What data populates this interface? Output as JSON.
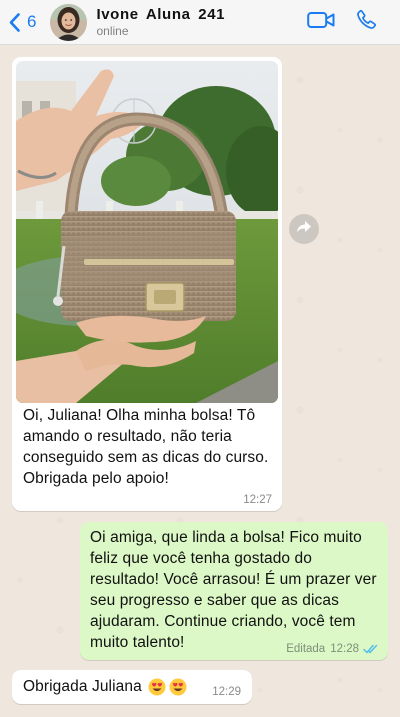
{
  "header": {
    "back_count": "6",
    "contact_name": "Ivone  Aluna  241",
    "status": "online",
    "icons": [
      "back-chevron-icon",
      "video-call-icon",
      "phone-call-icon"
    ]
  },
  "messages": [
    {
      "direction": "incoming",
      "has_image": true,
      "image_subject": "handmade crochet handbag",
      "text": "Oi, Juliana! Olha minha bolsa! Tô amando o resultado, não teria conseguido sem as dicas do curso. Obrigada pelo apoio!",
      "time": "12:27"
    },
    {
      "direction": "outgoing",
      "text": "Oi amiga, que linda a bolsa! Fico muito feliz que você tenha gostado do resultado! Você arrasou! É um prazer ver seu progresso e saber que as dicas ajudaram. Continue criando, você tem muito talento!",
      "edited_label": "Editada",
      "time": "12:28",
      "read": true
    },
    {
      "direction": "incoming",
      "text": "Obrigada Juliana",
      "emojis": [
        "heart-eyes-emoji",
        "heart-eyes-emoji"
      ],
      "time": "12:29"
    }
  ],
  "colors": {
    "accent": "#1A7CF0",
    "outgoing_bubble": "#DCF8C6",
    "incoming_bubble": "#FFFFFF",
    "read_ticks": "#53BDEB",
    "background": "#EFE7DE"
  }
}
